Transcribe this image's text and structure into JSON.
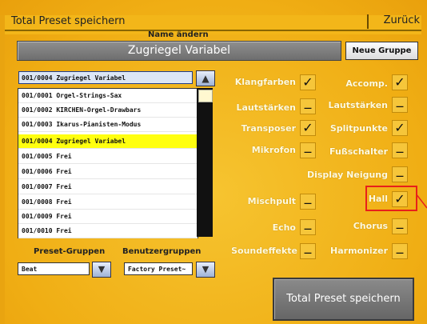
{
  "header": {
    "title": "Total Preset speichern",
    "back_label": "Zurück"
  },
  "name": {
    "label": "Name ändern",
    "value": "Zugriegel Variabel",
    "new_group_label": "Neue Gruppe"
  },
  "list": {
    "header": "001/0004  Zugriegel Variabel",
    "items": [
      "001/0001  Orgel-Strings-Sax",
      "001/0002  KIRCHEN-Orgel-Drawbars",
      "001/0003  Ikarus-Pianisten-Modus",
      "001/0004  Zugriegel Variabel",
      "001/0005 Frei",
      "001/0006 Frei",
      "001/0007 Frei",
      "001/0008 Frei",
      "001/0009 Frei",
      "001/0010 Frei"
    ],
    "selected_index": 3
  },
  "groups": {
    "preset_label": "Preset-Gruppen",
    "preset_value": "Beat",
    "user_label": "Benutzergruppen",
    "user_value": "Factory Preset~"
  },
  "options_left": [
    {
      "label": "Klangfarben",
      "checked": true
    },
    {
      "label": "Lautstärken",
      "checked": false
    },
    {
      "label": "Transposer",
      "checked": true
    },
    {
      "label": "Mikrofon",
      "checked": false
    },
    {
      "label": "Mischpult",
      "checked": false
    },
    {
      "label": "Echo",
      "checked": false
    },
    {
      "label": "Soundeffekte",
      "checked": false
    }
  ],
  "options_right": [
    {
      "label": "Accomp.",
      "checked": true
    },
    {
      "label": "Lautstärken",
      "checked": false
    },
    {
      "label": "Splitpunkte",
      "checked": true
    },
    {
      "label": "Fußschalter",
      "checked": false
    },
    {
      "label": "Display Neigung",
      "checked": false
    },
    {
      "label": "Hall",
      "checked": true
    },
    {
      "label": "Chorus",
      "checked": false
    },
    {
      "label": "Harmonizer",
      "checked": false
    }
  ],
  "save_button_label": "Total Preset speichern",
  "glyphs": {
    "check": "✓",
    "dash": "—",
    "up_arrow": "▲",
    "down_arrow": "▼"
  },
  "colors": {
    "selected_row": "#ffff10",
    "highlight": "#e8201a"
  }
}
